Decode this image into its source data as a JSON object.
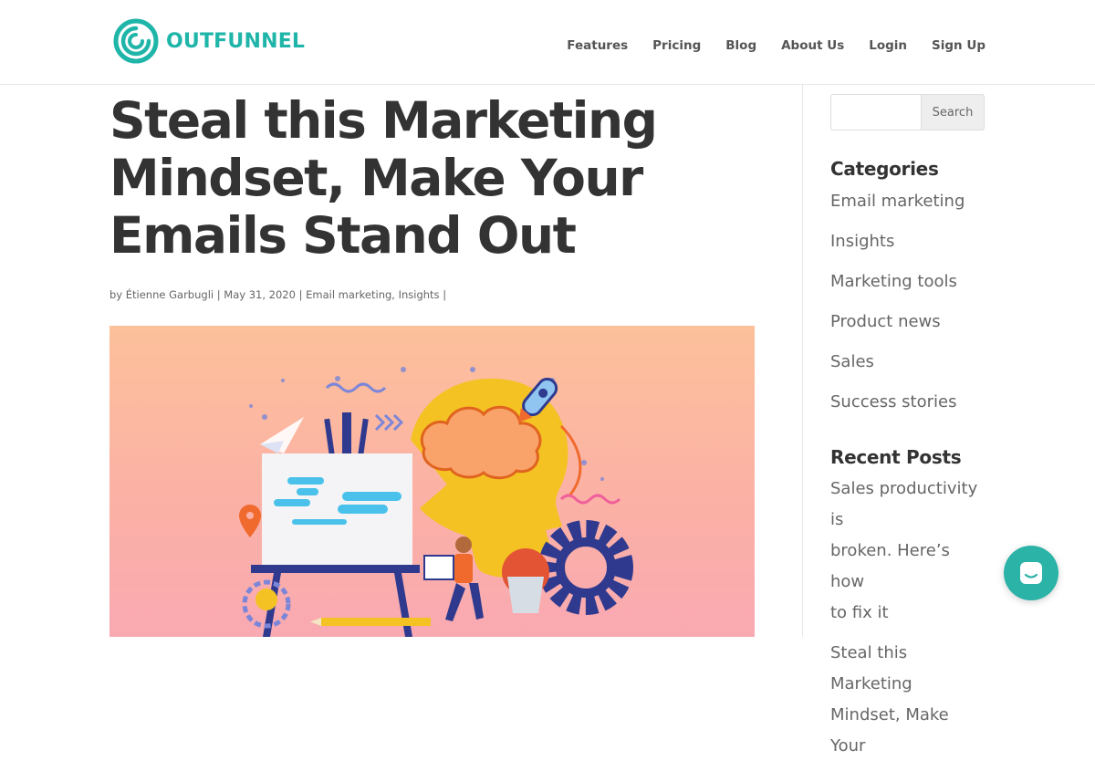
{
  "brand": {
    "name": "OUTFUNNEL",
    "color": "#1fb5a9"
  },
  "nav": {
    "items": [
      "Features",
      "Pricing",
      "Blog",
      "About Us",
      "Login",
      "Sign Up"
    ]
  },
  "post": {
    "title_lines": [
      "Steal this Marketing",
      "Mindset, Make Your",
      "Emails Stand Out"
    ],
    "meta": {
      "by": "by",
      "author": "Étienne Garbugli",
      "sep1": " | ",
      "date": "May 31, 2020",
      "sep2": " | ",
      "category1": "Email marketing",
      "comma": ", ",
      "category2": "Insights",
      "sep3": " |"
    }
  },
  "search": {
    "placeholder": "",
    "button_label": "Search"
  },
  "categories": {
    "title": "Categories",
    "items": [
      "Email marketing",
      "Insights",
      "Marketing tools",
      "Product news",
      "Sales",
      "Success stories"
    ]
  },
  "recent_posts": {
    "title": "Recent Posts",
    "items": [
      [
        "Sales productivity is",
        "broken. Here’s how",
        "to fix it"
      ],
      [
        "Steal this Marketing",
        "Mindset, Make Your"
      ]
    ]
  },
  "colors": {
    "hero_top": "#fcc09a",
    "hero_bottom": "#f9a9b2",
    "chat": "#2bb3a8"
  }
}
